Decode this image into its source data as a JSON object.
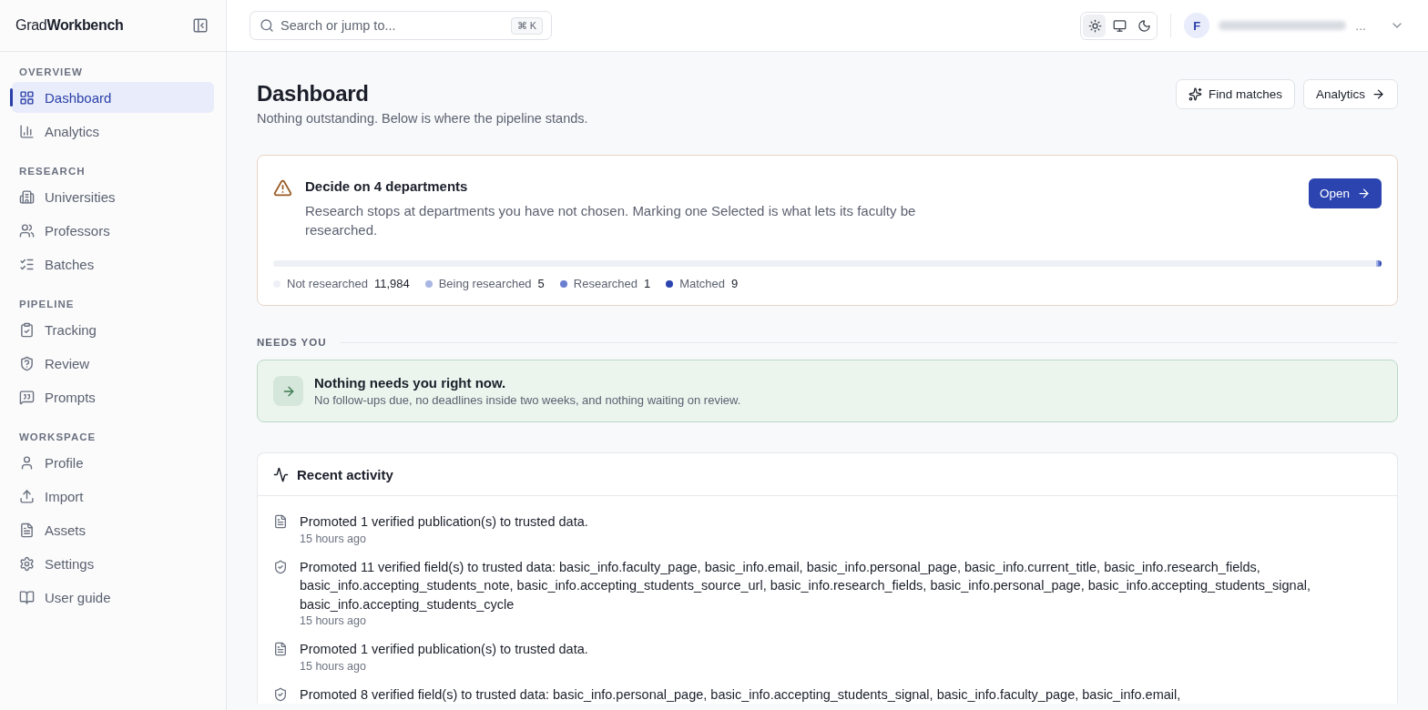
{
  "brand": {
    "light": "Grad",
    "bold": "Workbench"
  },
  "sidebar": {
    "sections": [
      {
        "title": "OVERVIEW",
        "items": [
          {
            "label": "Dashboard",
            "selected": true
          },
          {
            "label": "Analytics",
            "selected": false
          }
        ]
      },
      {
        "title": "RESEARCH",
        "items": [
          {
            "label": "Universities",
            "selected": false
          },
          {
            "label": "Professors",
            "selected": false
          },
          {
            "label": "Batches",
            "selected": false
          }
        ]
      },
      {
        "title": "PIPELINE",
        "items": [
          {
            "label": "Tracking",
            "selected": false
          },
          {
            "label": "Review",
            "selected": false
          },
          {
            "label": "Prompts",
            "selected": false
          }
        ]
      },
      {
        "title": "WORKSPACE",
        "items": [
          {
            "label": "Profile",
            "selected": false
          },
          {
            "label": "Import",
            "selected": false
          },
          {
            "label": "Assets",
            "selected": false
          },
          {
            "label": "Settings",
            "selected": false
          },
          {
            "label": "User guide",
            "selected": false
          }
        ]
      }
    ]
  },
  "search": {
    "placeholder": "Search or jump to...",
    "shortcut": "⌘ K"
  },
  "theme_modes": [
    {
      "selected": true
    },
    {
      "selected": false
    },
    {
      "selected": false
    }
  ],
  "user": {
    "initial": "F",
    "name": "..."
  },
  "page": {
    "title": "Dashboard",
    "subtitle": "Nothing outstanding. Below is where the pipeline stands.",
    "actions": [
      {
        "label": "Find matches",
        "kind": "sparkle"
      },
      {
        "label": "Analytics",
        "kind": "arrow"
      }
    ]
  },
  "alert": {
    "title": "Decide on 4 departments",
    "text": "Research stops at departments you have not chosen. Marking one Selected is what lets its faculty be researched.",
    "button": "Open",
    "segments": [
      {
        "label": "Not researched",
        "count": "11,984",
        "color": "#eef0f6"
      },
      {
        "label": "Being researched",
        "count": "5",
        "color": "#a9b6e3"
      },
      {
        "label": "Researched",
        "count": "1",
        "color": "#6b7fd0"
      },
      {
        "label": "Matched",
        "count": "9",
        "color": "#2b44b0"
      }
    ]
  },
  "needs_you": {
    "heading": "NEEDS YOU",
    "title": "Nothing needs you right now.",
    "text": "No follow-ups due, no deadlines inside two weeks, and nothing waiting on review."
  },
  "activity": {
    "title": "Recent activity",
    "items": [
      {
        "kind": "publication",
        "text": "Promoted 1 verified publication(s) to trusted data.",
        "time": "15 hours ago"
      },
      {
        "kind": "field",
        "text": "Promoted 11 verified field(s) to trusted data: basic_info.faculty_page, basic_info.email, basic_info.personal_page, basic_info.current_title, basic_info.research_fields, basic_info.accepting_students_note, basic_info.accepting_students_source_url, basic_info.research_fields, basic_info.personal_page, basic_info.accepting_students_signal, basic_info.accepting_students_cycle",
        "time": "15 hours ago"
      },
      {
        "kind": "publication",
        "text": "Promoted 1 verified publication(s) to trusted data.",
        "time": "15 hours ago"
      },
      {
        "kind": "field",
        "text": "Promoted 8 verified field(s) to trusted data: basic_info.personal_page, basic_info.accepting_students_signal, basic_info.faculty_page, basic_info.email,"
      }
    ]
  }
}
